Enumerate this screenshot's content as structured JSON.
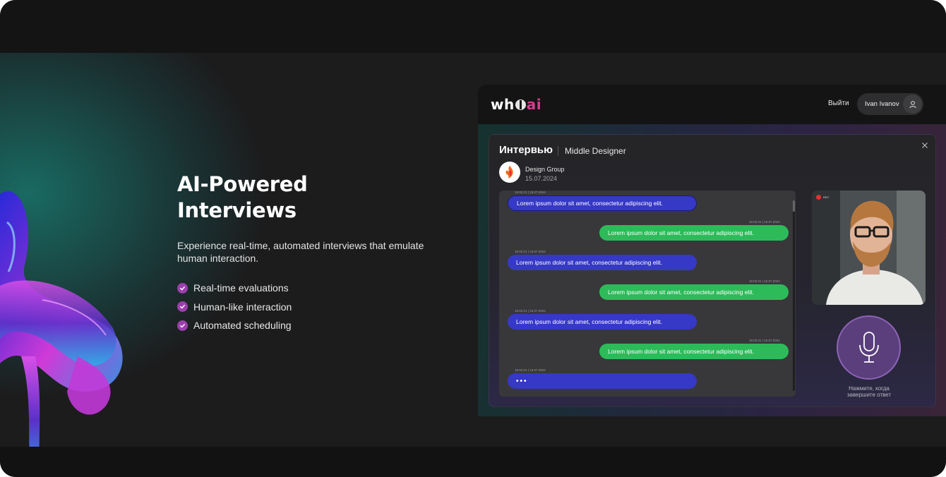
{
  "hero": {
    "title": "AI-Powered\nInterviews",
    "description": "Experience real-time, automated interviews that emulate human interaction.",
    "features": [
      "Real-time evaluations",
      "Human-like interaction",
      "Automated scheduling"
    ]
  },
  "app": {
    "logo": {
      "part1": "wh",
      "part2": "ai"
    },
    "logout_label": "Выйти",
    "user_name": "Ivan Ivanov",
    "modal": {
      "title": "Интервью",
      "role": "Middle Designer",
      "company": "Design Group",
      "date": "15.07.2024",
      "messages": [
        {
          "sender": "ai",
          "timestamp": "15:02:21 | 15.07.2024",
          "text": "Lorem ipsum dolor sit amet, consectetur adipiscing elit."
        },
        {
          "sender": "user",
          "timestamp": "15:02:21 | 15.07.2024",
          "text": "Lorem ipsum dolor sit amet, consectetur adipiscing elit."
        },
        {
          "sender": "ai",
          "timestamp": "15:02:21 | 15.07.2024",
          "text": "Lorem ipsum dolor sit amet, consectetur adipiscing elit."
        },
        {
          "sender": "user",
          "timestamp": "15:02:21 | 15.07.2024",
          "text": "Lorem ipsum dolor sit amet, consectetur adipiscing elit."
        },
        {
          "sender": "ai",
          "timestamp": "15:02:21 | 15.07.2024",
          "text": "Lorem ipsum dolor sit amet, consectetur adipiscing elit."
        },
        {
          "sender": "user",
          "timestamp": "15:02:21 | 15.07.2024",
          "text": "Lorem ipsum dolor sit amet, consectetur adipiscing elit."
        },
        {
          "sender": "ai",
          "timestamp": "15:02:21 | 15.07.2024",
          "text": "•••"
        }
      ],
      "recording_label": "REC",
      "mic_hint": "Нажмите, когда\nзавершите ответ"
    }
  },
  "colors": {
    "accent_purple": "#9c3fae",
    "ai_bubble": "#3638c6",
    "user_bubble": "#2dbb5a",
    "logo_ai": "#d23f8c"
  },
  "icons": [
    "check-icon",
    "user-icon",
    "close-icon",
    "microphone-icon",
    "company-logo-icon"
  ]
}
